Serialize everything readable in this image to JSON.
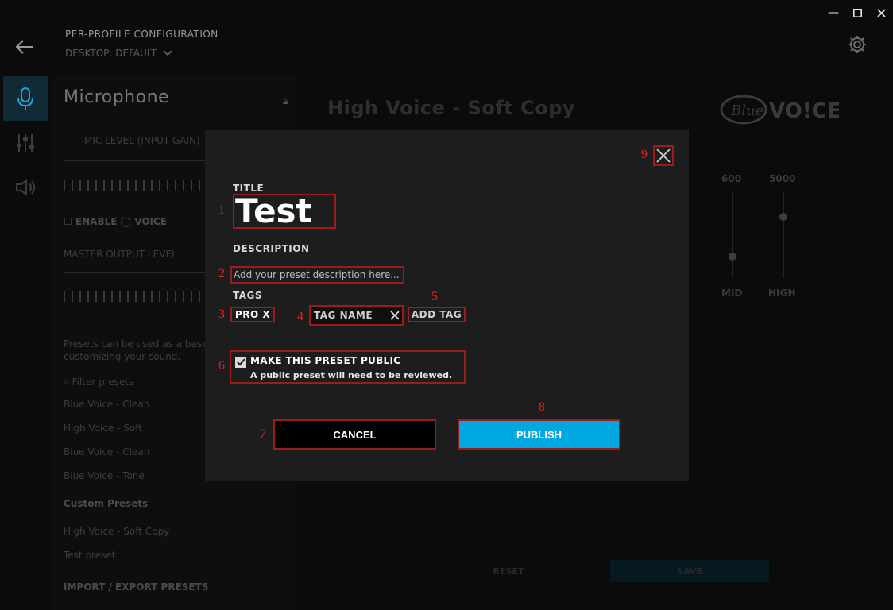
{
  "window": {
    "minimize_glyph": "—",
    "maximize_glyph": "☐",
    "close_glyph": "✕"
  },
  "header": {
    "section_label": "PER-PROFILE CONFIGURATION",
    "profile_name": "DESKTOP: DEFAULT",
    "back_icon": "back-arrow-icon",
    "settings_icon": "gear-icon"
  },
  "rail": {
    "items": [
      {
        "icon": "microphone-icon",
        "active": true
      },
      {
        "icon": "equalizer-icon",
        "active": false
      },
      {
        "icon": "speaker-icon",
        "active": false
      }
    ]
  },
  "sidebar": {
    "title": "Microphone",
    "mic_level_label": "MIC LEVEL (INPUT GAIN)",
    "enable_label": "ENABLE",
    "voice_label": "VOICE",
    "master_output_label": "MASTER OUTPUT LEVEL",
    "presets_help": "Presets can be used as a base for",
    "presets_help_2": "customizing your sound.",
    "filter_placeholder": "Filter presets",
    "presets": [
      "Blue Voice - Clean",
      "High Voice - Soft",
      "Blue Voice - Clean",
      "Blue Voice - Tone"
    ],
    "custom_presets_label": "Custom Presets",
    "custom_presets": [
      "High Voice - Soft Copy",
      "Test preset"
    ],
    "import_label": "IMPORT / EXPORT PRESETS"
  },
  "main": {
    "preset_title": "High Voice - Soft Copy",
    "logo_text": "VO!CE",
    "logo_script": "Blue",
    "eq": [
      {
        "label": "600",
        "level": 0.25
      },
      {
        "label": "5000",
        "level": 0.7
      }
    ],
    "eq_bottom_labels": [
      "MID",
      "HIGH"
    ],
    "footer_buttons": [
      "RESET",
      "SAVE"
    ]
  },
  "modal": {
    "title_label": "TITLE",
    "title_value": "Test",
    "description_label": "DESCRIPTION",
    "description_placeholder": "Add your preset description here...",
    "tags_label": "TAGS",
    "tag_chip": "PRO X",
    "tag_input_placeholder": "TAG NAME",
    "add_tag_label": "ADD TAG",
    "public_checked": true,
    "public_title": "MAKE THIS PRESET PUBLIC",
    "public_subtitle": "A public preset will need to be reviewed.",
    "cancel_label": "CANCEL",
    "publish_label": "PUBLISH",
    "accent_color": "#00a8e1"
  },
  "annotations": [
    "1",
    "2",
    "3",
    "4",
    "5",
    "6",
    "7",
    "8",
    "9"
  ]
}
